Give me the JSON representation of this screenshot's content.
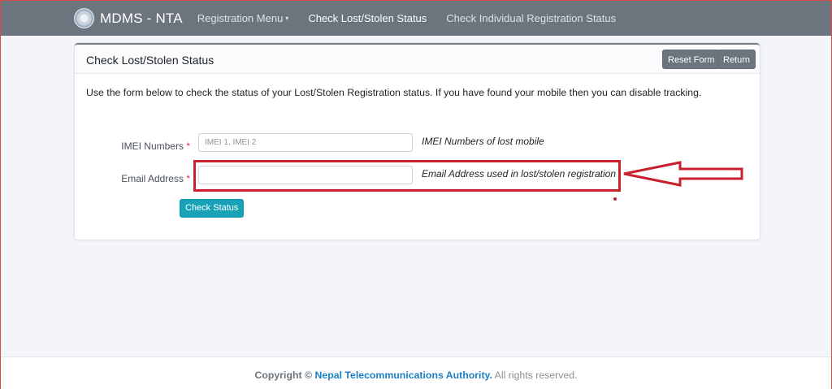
{
  "navbar": {
    "brand": "MDMS - NTA",
    "logo_icon": "nta-seal-icon",
    "items": [
      {
        "label": "Registration Menu",
        "has_caret": true
      },
      {
        "label": "Check Lost/Stolen Status",
        "active": true
      },
      {
        "label": "Check Individual Registration Status"
      }
    ],
    "caret": "▾"
  },
  "card": {
    "title": "Check Lost/Stolen Status",
    "reset_label": "Reset Form",
    "return_label": "Return",
    "intro": "Use the form below to check the status of your Lost/Stolen Registration status. If you have found your mobile then you can disable tracking.",
    "fields": {
      "imei": {
        "label": "IMEI Numbers",
        "required_mark": "*",
        "placeholder": "IMEI 1, IMEI 2",
        "value": "",
        "help": "IMEI Numbers of lost mobile"
      },
      "email": {
        "label": "Email Address",
        "required_mark": "*",
        "placeholder": "",
        "value": "",
        "help": "Email Address used in lost/stolen registration"
      }
    },
    "submit_label": "Check Status"
  },
  "annotation": {
    "color": "#c8202c",
    "shapes": [
      "highlight-box",
      "left-arrow"
    ]
  },
  "footer": {
    "copyright": "Copyright ©",
    "org": "Nepal Telecommunications Authority.",
    "rights": "All rights reserved."
  },
  "colors": {
    "navbar_bg": "#6c757d",
    "primary_button": "#17a2b8",
    "secondary_button": "#6c757d",
    "required": "#dc3545",
    "link": "#1b7fc4"
  }
}
